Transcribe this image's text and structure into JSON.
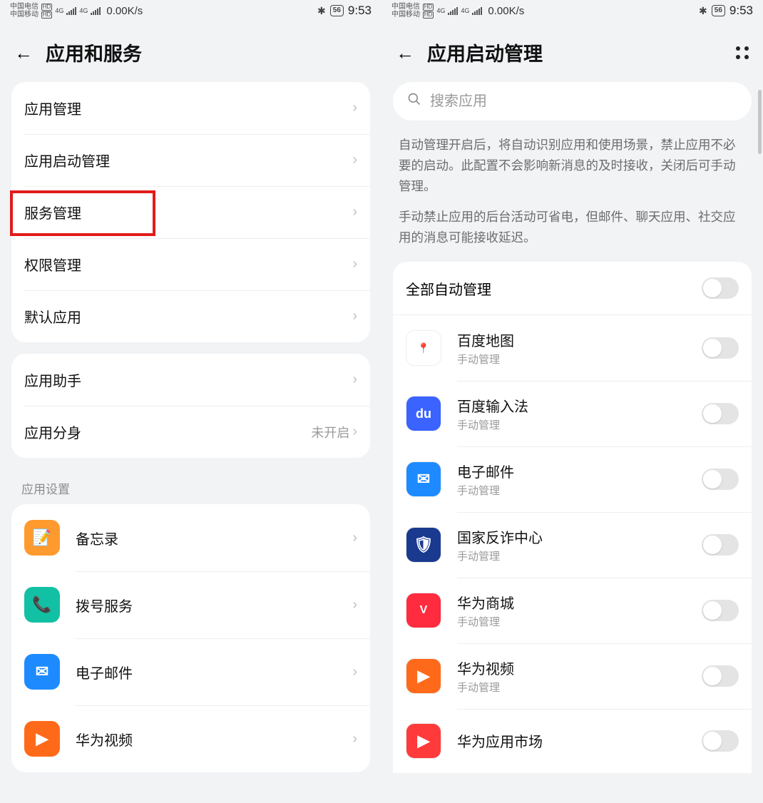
{
  "status": {
    "carrier1": "中国电信",
    "carrier2": "中国移动",
    "hd": "HD",
    "net_indicator": "4G",
    "speed": "0.00K/s",
    "battery_label": "56",
    "time": "9:53"
  },
  "left": {
    "title": "应用和服务",
    "group1": [
      {
        "label": "应用管理"
      },
      {
        "label": "应用启动管理"
      },
      {
        "label": "服务管理"
      },
      {
        "label": "权限管理"
      },
      {
        "label": "默认应用"
      }
    ],
    "group2": [
      {
        "label": "应用助手",
        "value": ""
      },
      {
        "label": "应用分身",
        "value": "未开启"
      }
    ],
    "section_label": "应用设置",
    "apps": [
      {
        "label": "备忘录",
        "icon_bg": "#ff9a2e",
        "icon_text": "📝"
      },
      {
        "label": "拨号服务",
        "icon_bg": "#12c0a4",
        "icon_text": "📞"
      },
      {
        "label": "电子邮件",
        "icon_bg": "#1d8bff",
        "icon_text": "✉"
      },
      {
        "label": "华为视频",
        "icon_bg": "#ff6a1a",
        "icon_text": "▶"
      }
    ]
  },
  "right": {
    "title": "应用启动管理",
    "search_placeholder": "搜索应用",
    "desc1": "自动管理开启后，将自动识别应用和使用场景，禁止应用不必要的启动。此配置不会影响新消息的及时接收，关闭后可手动管理。",
    "desc2": "手动禁止应用的后台活动可省电，但邮件、聊天应用、社交应用的消息可能接收延迟。",
    "all_label": "全部自动管理",
    "apps": [
      {
        "name": "百度地图",
        "sub": "手动管理",
        "icon_bg": "#ffffff",
        "icon_text": "🔴"
      },
      {
        "name": "百度输入法",
        "sub": "手动管理",
        "icon_bg": "#3a63ff",
        "icon_text": "du"
      },
      {
        "name": "电子邮件",
        "sub": "手动管理",
        "icon_bg": "#1d8bff",
        "icon_text": "✉"
      },
      {
        "name": "国家反诈中心",
        "sub": "手动管理",
        "icon_bg": "#1a3a8f",
        "icon_text": "🛡"
      },
      {
        "name": "华为商城",
        "sub": "手动管理",
        "icon_bg": "#ff2b3e",
        "icon_text": "V"
      },
      {
        "name": "华为视频",
        "sub": "手动管理",
        "icon_bg": "#ff6a1a",
        "icon_text": "▶"
      },
      {
        "name": "华为应用市场",
        "sub": "",
        "icon_bg": "#ff3a3a",
        "icon_text": "▶"
      }
    ]
  }
}
